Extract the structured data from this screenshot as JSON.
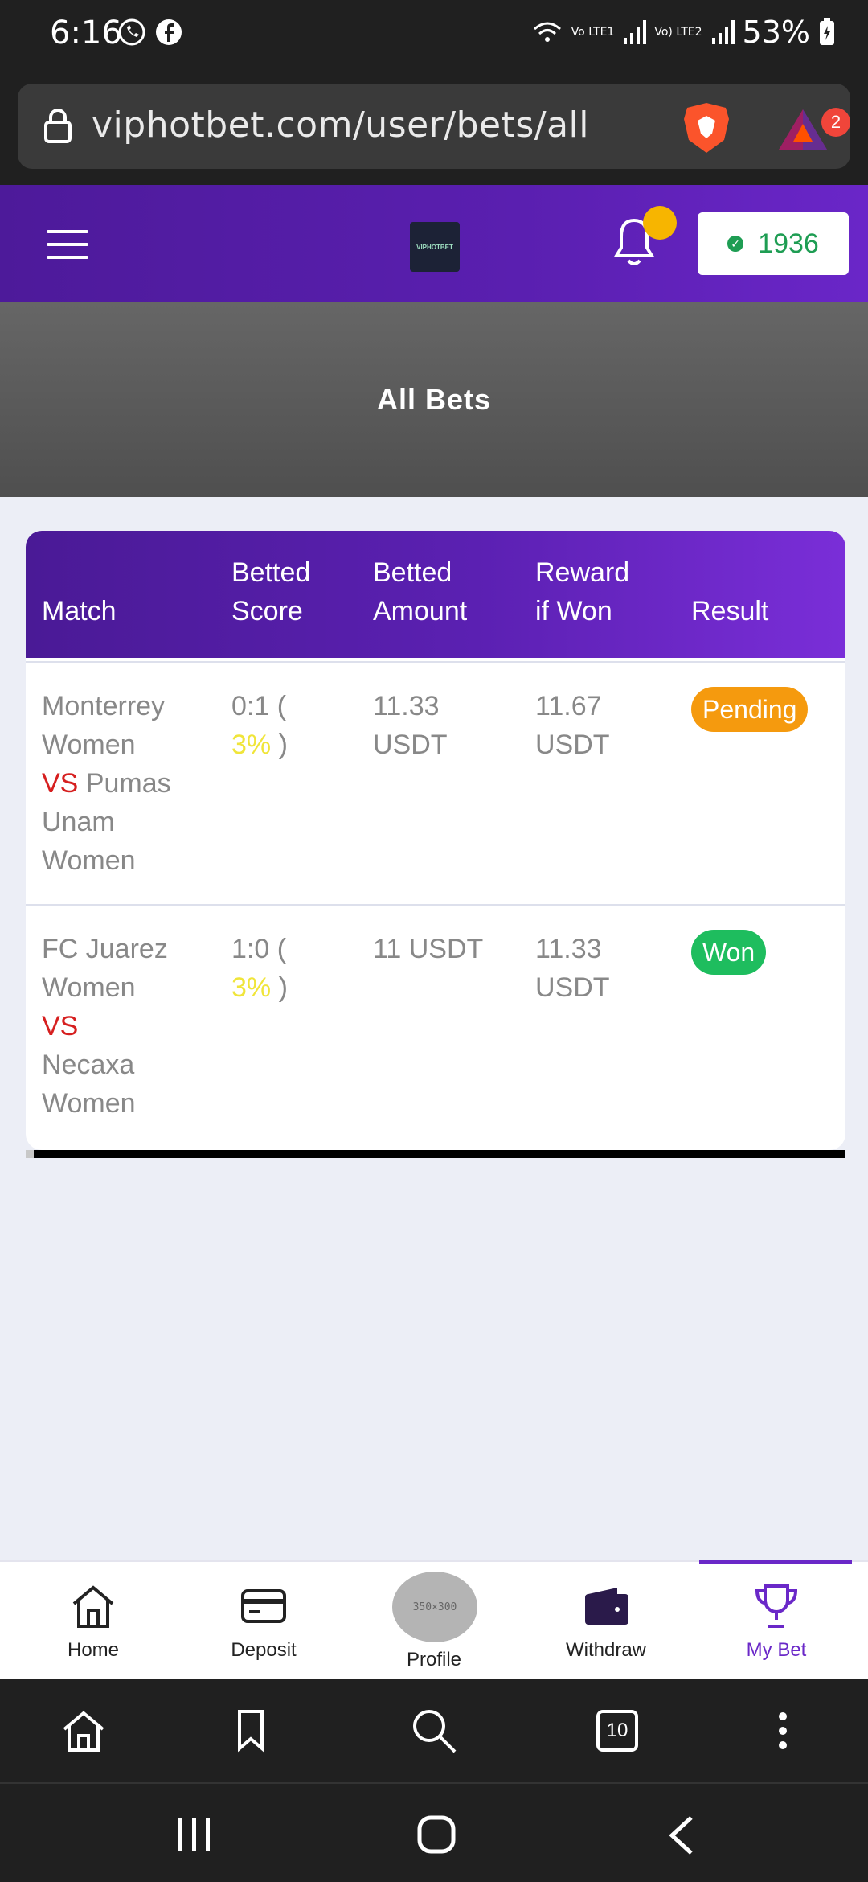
{
  "status_bar": {
    "time": "6:16",
    "network_1": "Vo LTE1",
    "network_2": "Vo) LTE2",
    "battery": "53%"
  },
  "address_bar": {
    "url": "viphotbet.com/user/bets/all",
    "rewards_badge": "2"
  },
  "header": {
    "logo_text": "VIPHOTBET",
    "balance": "1936"
  },
  "banner": {
    "title": "All Bets"
  },
  "table": {
    "headers": {
      "match": "Match",
      "betted_score_1": "Betted",
      "betted_score_2": "Score",
      "betted_amount_1": "Betted",
      "betted_amount_2": "Amount",
      "reward_1": "Reward",
      "reward_2": "if Won",
      "result": "Result"
    },
    "rows": [
      {
        "team_a_1": "Monterrey",
        "team_a_2": "Women",
        "vs": "VS",
        "team_b_inline": "Pumas",
        "team_b_1": "Unam",
        "team_b_2": "Women",
        "score": "0:1 (",
        "pct": "3%",
        "score_close": ")",
        "amount_1": "11.33",
        "amount_2": "USDT",
        "reward_1": "11.67",
        "reward_2": "USDT",
        "result": "Pending"
      },
      {
        "team_a_1": "FC Juarez",
        "team_a_2": "Women",
        "vs": "VS",
        "team_b_1": "Necaxa",
        "team_b_2": "Women",
        "score": "1:0 (",
        "pct": "3%",
        "score_close": ")",
        "amount_1": "11 USDT",
        "reward_1": "11.33",
        "reward_2": "USDT",
        "result": "Won"
      }
    ]
  },
  "bottom_nav": {
    "home": "Home",
    "deposit": "Deposit",
    "profile": "Profile",
    "profile_placeholder": "350×300",
    "withdraw": "Withdraw",
    "my_bet": "My Bet"
  },
  "browser_toolbar": {
    "tab_count": "10"
  },
  "colors": {
    "brand_purple": "#5a1fb0",
    "pending": "#f59a0e",
    "won": "#1ebd5e",
    "vs": "#d61f1f",
    "percent": "#f0e53a"
  }
}
